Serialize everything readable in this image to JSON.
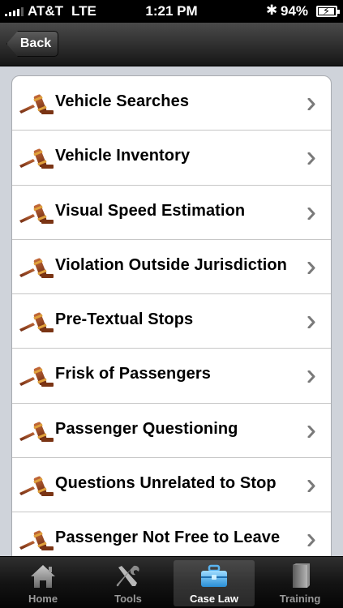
{
  "status_bar": {
    "carrier": "AT&T",
    "network": "LTE",
    "time": "1:21 PM",
    "battery": "94%"
  },
  "nav": {
    "back_label": "Back"
  },
  "list": {
    "items": [
      {
        "label": "Vehicle Searches"
      },
      {
        "label": "Vehicle Inventory"
      },
      {
        "label": "Visual Speed Estimation"
      },
      {
        "label": "Violation Outside Jurisdiction"
      },
      {
        "label": "Pre-Textual Stops"
      },
      {
        "label": "Frisk of Passengers"
      },
      {
        "label": "Passenger Questioning"
      },
      {
        "label": "Questions Unrelated to Stop"
      },
      {
        "label": "Passenger Not Free to Leave"
      }
    ]
  },
  "tab_bar": {
    "tabs": [
      {
        "label": "Home",
        "icon": "home-icon"
      },
      {
        "label": "Tools",
        "icon": "tools-icon"
      },
      {
        "label": "Case Law",
        "icon": "briefcase-icon",
        "active": true
      },
      {
        "label": "Training",
        "icon": "book-icon"
      }
    ]
  },
  "colors": {
    "list_background": "#cfd3da",
    "gavel_wood": "#8b3a1a",
    "active_tab_icon": "#5ab4f0"
  }
}
